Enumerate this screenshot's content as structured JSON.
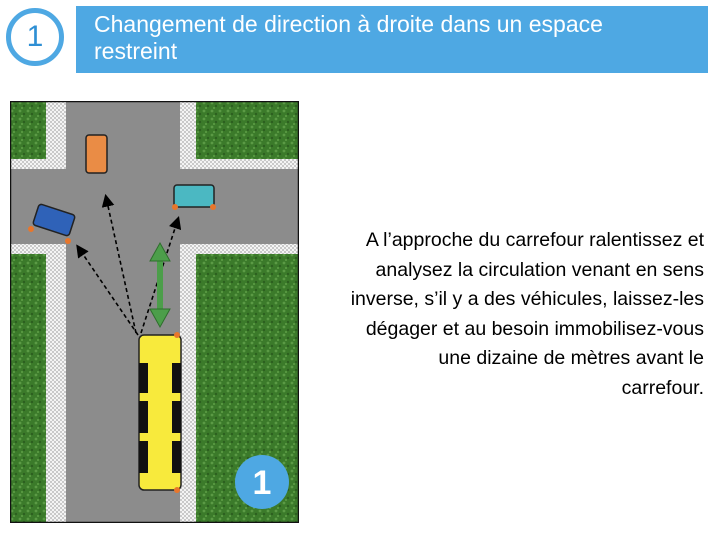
{
  "header": {
    "step_number": "1",
    "title": "Changement de direction à droite dans un espace restreint"
  },
  "diagram": {
    "badge_number": "1",
    "vehicles": [
      {
        "id": "bus",
        "color": "#f8ea3c"
      },
      {
        "id": "orange-car",
        "color": "#ea8c45"
      },
      {
        "id": "teal-car",
        "color": "#4bb8c2"
      },
      {
        "id": "blue-car",
        "color": "#2f62b8"
      }
    ],
    "colors": {
      "grass": "#3b7a2a",
      "road": "#8c8c8c",
      "arrow": "#4c9e4a",
      "badge": "#4ea8e3"
    }
  },
  "description": "A l’approche du carrefour ralentissez et\nanalysez la circulation venant en sens\ninverse, s’il y a des véhicules, laissez-les\ndégager et au besoin immobilisez-vous\nune dizaine de mètres avant le\ncarrefour."
}
